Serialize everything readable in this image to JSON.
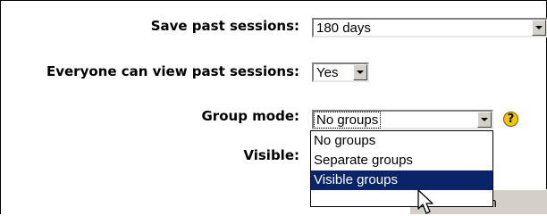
{
  "fields": {
    "save_past_sessions": {
      "label": "Save past sessions:",
      "value": "180 days"
    },
    "everyone_can_view": {
      "label": "Everyone can view past sessions:",
      "value": "Yes"
    },
    "group_mode": {
      "label": "Group mode:",
      "value": "No groups",
      "options": [
        "No groups",
        "Separate groups",
        "Visible groups"
      ],
      "highlighted_option": "Visible groups"
    },
    "visible": {
      "label": "Visible:"
    }
  },
  "help_icon_glyph": "?",
  "save_button_label": "Save chan",
  "colors": {
    "highlight": "#0a246a",
    "help_icon": "#f7c400",
    "button_face": "#d4d0c8"
  },
  "icons": {
    "help": "help-icon",
    "cursor": "mouse-pointer-icon"
  }
}
